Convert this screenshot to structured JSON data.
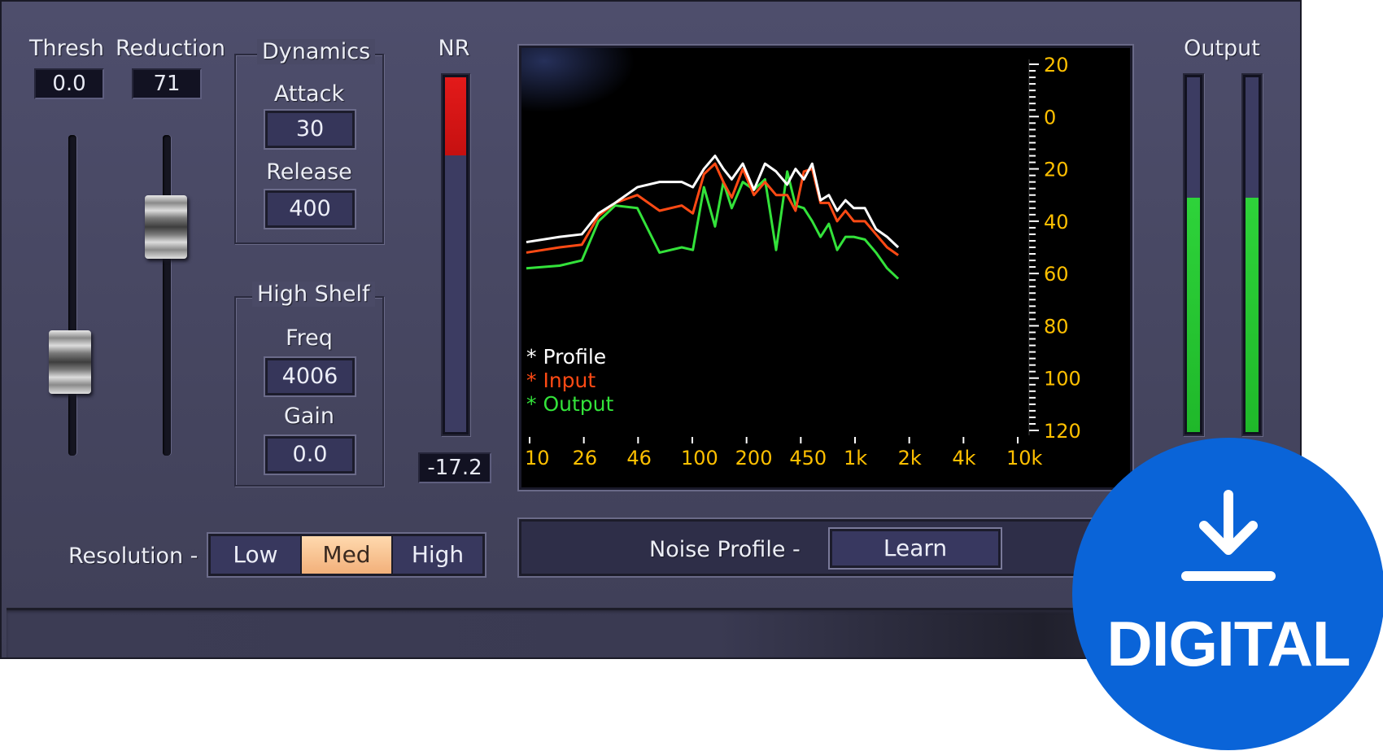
{
  "controls": {
    "thresh": {
      "label": "Thresh",
      "value": "0.0"
    },
    "reduction": {
      "label": "Reduction",
      "value": "71"
    }
  },
  "dynamics": {
    "title": "Dynamics",
    "attack_label": "Attack",
    "attack_value": "30",
    "release_label": "Release",
    "release_value": "400"
  },
  "high_shelf": {
    "title": "High Shelf",
    "freq_label": "Freq",
    "freq_value": "4006",
    "gain_label": "Gain",
    "gain_value": "0.0"
  },
  "nr": {
    "label": "NR",
    "value": "-17.2",
    "level": 0.78
  },
  "output": {
    "label": "Output",
    "left_level": 0.66,
    "right_level": 0.66
  },
  "resolution": {
    "label": "Resolution -",
    "options": [
      "Low",
      "Med",
      "High"
    ],
    "selected": "Med"
  },
  "noise_profile": {
    "label": "Noise Profile -",
    "button": "Learn"
  },
  "badge": {
    "text": "DIGITAL",
    "icon": "download-icon"
  },
  "colors": {
    "profile": "#ffffff",
    "input": "#ff4a14",
    "output": "#33e23a",
    "ticks": "#ffc000"
  },
  "chart_data": {
    "type": "line",
    "x_tick_labels": [
      "10",
      "26",
      "46",
      "100",
      "200",
      "450",
      "1k",
      "2k",
      "4k",
      "10k"
    ],
    "y_tick_labels": [
      "20",
      "0",
      "20",
      "40",
      "60",
      "80",
      "100",
      "120"
    ],
    "ylim": [
      -20,
      120
    ],
    "legend": [
      "* Profile",
      "* Input",
      "* Output"
    ],
    "legend_position": "bottom-left",
    "x": [
      0,
      0.6,
      1,
      1.3,
      1.6,
      2,
      2.4,
      2.8,
      3,
      3.2,
      3.4,
      3.55,
      3.7,
      3.9,
      4.1,
      4.3,
      4.5,
      4.7,
      4.85,
      5,
      5.15,
      5.3,
      5.45,
      5.6,
      5.75,
      5.9,
      6.1,
      6.3,
      6.5,
      6.7,
      6.9,
      7.1,
      7.3,
      7.6,
      7.9,
      8.2,
      8.5,
      8.8,
      9
    ],
    "series": [
      {
        "name": "* Profile",
        "values": [
          48,
          46,
          45,
          37,
          33,
          27,
          25,
          25,
          27,
          20,
          15,
          20,
          24,
          18,
          28,
          18,
          21,
          26,
          20,
          24,
          18,
          32,
          30,
          36,
          32,
          35,
          35,
          43,
          46,
          50
        ]
      },
      {
        "name": "* Input",
        "values": [
          52,
          50,
          49,
          38,
          33,
          30,
          36,
          34,
          37,
          22,
          18,
          25,
          31,
          20,
          30,
          25,
          30,
          30,
          36,
          21,
          20,
          33,
          33,
          40,
          36,
          40,
          40,
          45,
          50,
          53
        ]
      },
      {
        "name": "* Output",
        "values": [
          58,
          57,
          55,
          40,
          34,
          35,
          52,
          50,
          51,
          27,
          42,
          25,
          35,
          25,
          28,
          24,
          51,
          21,
          34,
          35,
          40,
          46,
          41,
          51,
          46,
          46,
          47,
          52,
          58,
          62
        ]
      }
    ]
  }
}
